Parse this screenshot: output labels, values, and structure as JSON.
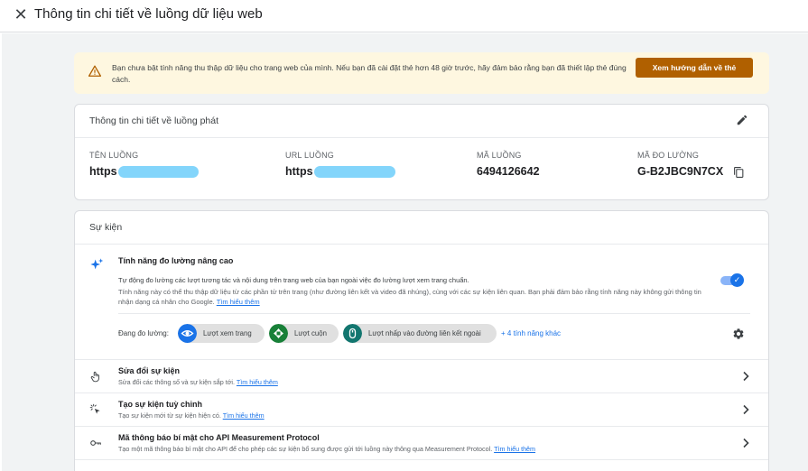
{
  "header": {
    "title": "Thông tin chi tiết về luồng dữ liệu web",
    "close_icon": "close-icon"
  },
  "banner": {
    "text": "Bạn chưa bật tính năng thu thập dữ liệu cho trang web của mình. Nếu bạn đã cài đặt thẻ hơn 48 giờ trước, hãy đảm bảo rằng bạn đã thiết lập thẻ đúng cách.",
    "button_label": "Xem hướng dẫn về thẻ",
    "accent": "#b06000"
  },
  "stream_details": {
    "title": "Thông tin chi tiết về luồng phát",
    "fields": [
      {
        "label": "TÊN LUỒNG",
        "value": "https"
      },
      {
        "label": "URL LUỒNG",
        "value": "https"
      },
      {
        "label": "MÃ LUỒNG",
        "value": "6494126642"
      },
      {
        "label": "MÃ ĐO LƯỜNG",
        "value": "G-B2JBC9N7CX"
      }
    ]
  },
  "events": {
    "title": "Sự kiện",
    "enhanced": {
      "title": "Tính năng đo lường nâng cao",
      "desc1": "Tự động đo lường các lượt tương tác và nội dung trên trang web của bạn ngoài việc đo lường lượt xem trang chuẩn.",
      "desc2": "Tính năng này có thể thu thập dữ liệu từ các phần tử trên trang (như đường liên kết và video đã nhúng), cùng với các sự kiện liên quan. Bạn phải đảm bảo rằng tính năng này không gửi thông tin nhận dạng cá nhân cho Google.",
      "learn_more": "Tìm hiểu thêm",
      "toggle_on": true,
      "measuring_label": "Đang đo lường:",
      "chips": [
        {
          "label": "Lượt xem trang",
          "color": "#1a73e8",
          "icon": "eye-icon"
        },
        {
          "label": "Lượt cuộn",
          "color": "#188038",
          "icon": "scroll-icon"
        },
        {
          "label": "Lượt nhấp vào đường liên kết ngoài",
          "color": "#12766f",
          "icon": "mouse-icon"
        }
      ],
      "more": "+ 4 tính năng khác"
    },
    "rows": [
      {
        "title": "Sửa đổi sự kiện",
        "desc": "Sửa đổi các thông số và sự kiện sắp tới.",
        "link": "Tìm hiểu thêm",
        "icon": "touch-icon"
      },
      {
        "title": "Tạo sự kiện tuỳ chỉnh",
        "desc": "Tạo sự kiện mới từ sự kiện hiện có.",
        "link": "Tìm hiểu thêm",
        "icon": "click-icon"
      },
      {
        "title": "Mã thông báo bí mật cho API Measurement Protocol",
        "desc": "Tạo một mã thông báo bí mật cho API để cho phép các sự kiện bổ sung được gửi tới luồng này thông qua Measurement Protocol.",
        "link": "Tìm hiểu thêm",
        "icon": "key-icon"
      }
    ]
  }
}
